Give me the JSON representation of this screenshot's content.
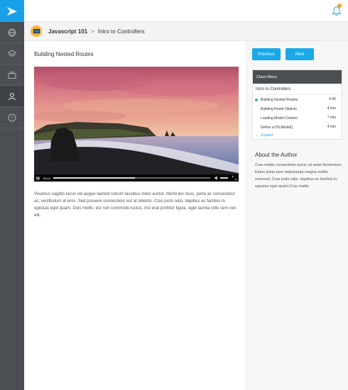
{
  "header": {
    "notification_badge_color": "#f5a623"
  },
  "breadcrumb": {
    "course": "Javascript 101",
    "separator": ">",
    "page": "Intro to Controllers"
  },
  "main": {
    "title": "Building Nested Routes",
    "video": {
      "time": "00:44",
      "progress_fraction": 0.52
    },
    "description": "Vivamus sagittis lacus vel augue laoreet rutrum faucibus dolor auctor. Morbi leo risus, porta ac consectetur ac, vestibulum at eros. Sed posuere consectetur est at lobortis. Cras justo odio, dapibus ac facilisis in, egestas eget quam. Duis mollis, est non commodo luctus, nisi erat porttitor ligula, eget lacinia odio sem nec elit."
  },
  "nav_buttons": {
    "previous": "Previous",
    "next": "Next"
  },
  "class_menu": {
    "header": "Class Menu",
    "section": "Intro to Controllers",
    "items": [
      {
        "label": "Building Nested Routes",
        "duration": "6:45",
        "current": true
      },
      {
        "label": "Building Route Objects",
        "duration": "4 min",
        "current": false
      },
      {
        "label": "Loading Model Content",
        "duration": "7 min",
        "current": false
      },
      {
        "label": "Define a DS.Model()",
        "duration": "4 min",
        "current": false
      }
    ],
    "expand": "Expand"
  },
  "author": {
    "title": "About the Author",
    "bio": "Cras mattis consectetur purus sit amet fermentum. Etiam porta sem malesuada magna mollis euismod. Cras justo odio, dapibus ac facilisis in, egestas eget quam.Cras mattis"
  },
  "sidebar": {
    "items": [
      {
        "icon": "globe-icon",
        "active": false
      },
      {
        "icon": "layers-icon",
        "active": false
      },
      {
        "icon": "briefcase-icon",
        "active": false
      },
      {
        "icon": "user-icon",
        "active": true
      },
      {
        "icon": "help-icon",
        "active": false
      }
    ]
  },
  "colors": {
    "accent": "#1aa8e8",
    "sidebar": "#4b4f54",
    "current_dot": "#3cb371"
  }
}
